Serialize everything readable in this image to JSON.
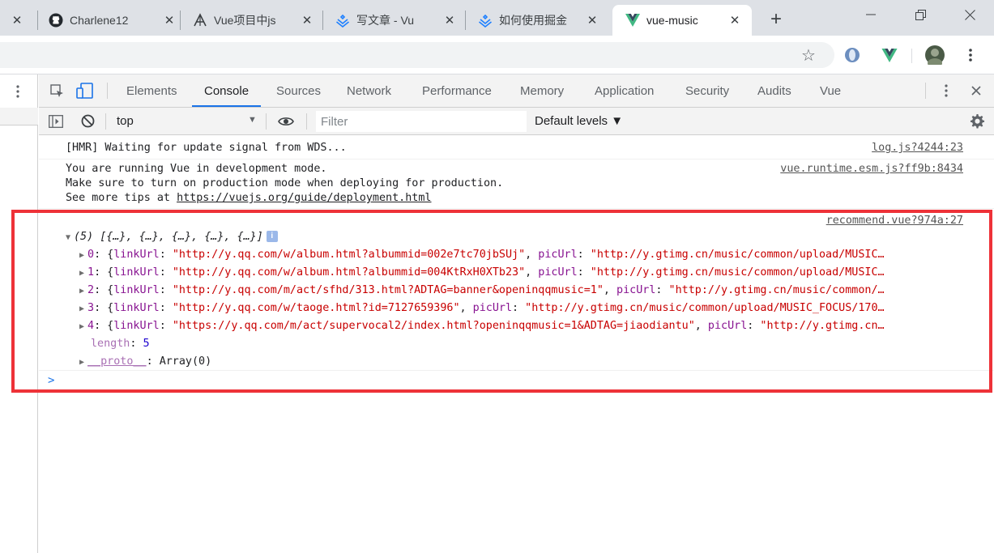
{
  "browser": {
    "tabs": [
      {
        "title": "",
        "favicon": "close-icon"
      },
      {
        "title": "Charlene12",
        "favicon": "github-icon"
      },
      {
        "title": "Vue项目中js",
        "favicon": "editor-logo-icon"
      },
      {
        "title": "写文章 - Vu",
        "favicon": "juejin-icon"
      },
      {
        "title": "如何使用掘金",
        "favicon": "juejin-icon"
      },
      {
        "title": "vue-music",
        "favicon": "vue-logo-icon",
        "active": true
      }
    ],
    "new_tab_symbol": "+",
    "window_controls": [
      "minimize",
      "restore",
      "close"
    ]
  },
  "devtools": {
    "tabs": [
      "Elements",
      "Console",
      "Sources",
      "Network",
      "Performance",
      "Memory",
      "Application",
      "Security",
      "Audits",
      "Vue"
    ],
    "active_tab": "Console",
    "console_toolbar": {
      "context": "top",
      "filter_placeholder": "Filter",
      "levels_label": "Default levels ▼"
    }
  },
  "console": {
    "messages": [
      {
        "text": "[HMR] Waiting for update signal from WDS...",
        "source": "log.js?4244:23"
      },
      {
        "lines": [
          "You are running Vue in development mode.",
          "Make sure to turn on production mode when deploying for production.",
          "See more tips at "
        ],
        "link": "https://vuejs.org/guide/deployment.html",
        "source": "vue.runtime.esm.js?ff9b:8434"
      }
    ],
    "array_log": {
      "source": "recommend.vue?974a:27",
      "summary": "(5) [{…}, {…}, {…}, {…}, {…}]",
      "items": [
        {
          "index": "0",
          "linkUrl": "\"http://y.qq.com/w/album.html?albummid=002e7tc70jbSUj\"",
          "picUrl": "\"http://y.gtimg.cn/music/common/upload/MUSIC…"
        },
        {
          "index": "1",
          "linkUrl": "\"http://y.qq.com/w/album.html?albummid=004KtRxH0XTb23\"",
          "picUrl": "\"http://y.gtimg.cn/music/common/upload/MUSIC…"
        },
        {
          "index": "2",
          "linkUrl": "\"http://y.qq.com/m/act/sfhd/313.html?ADTAG=banner&openinqqmusic=1\"",
          "picUrl": "\"http://y.gtimg.cn/music/common/…"
        },
        {
          "index": "3",
          "linkUrl": "\"http://y.qq.com/w/taoge.html?id=7127659396\"",
          "picUrl": "\"http://y.gtimg.cn/music/common/upload/MUSIC_FOCUS/170…"
        },
        {
          "index": "4",
          "linkUrl": "\"https://y.qq.com/m/act/supervocal2/index.html?openinqqmusic=1&ADTAG=jiaodiantu\"",
          "picUrl": "\"http://y.gtimg.cn…"
        }
      ],
      "length_key": "length",
      "length_value": "5",
      "proto_key": "__proto__",
      "proto_value": "Array(0)"
    },
    "prompt_symbol": ">"
  },
  "colors": {
    "tabstrip_bg": "#dee1e6",
    "accent": "#1a73e8",
    "highlight_border": "#ee3238",
    "string": "#c80000",
    "key": "#881391",
    "number": "#1c00cf"
  }
}
